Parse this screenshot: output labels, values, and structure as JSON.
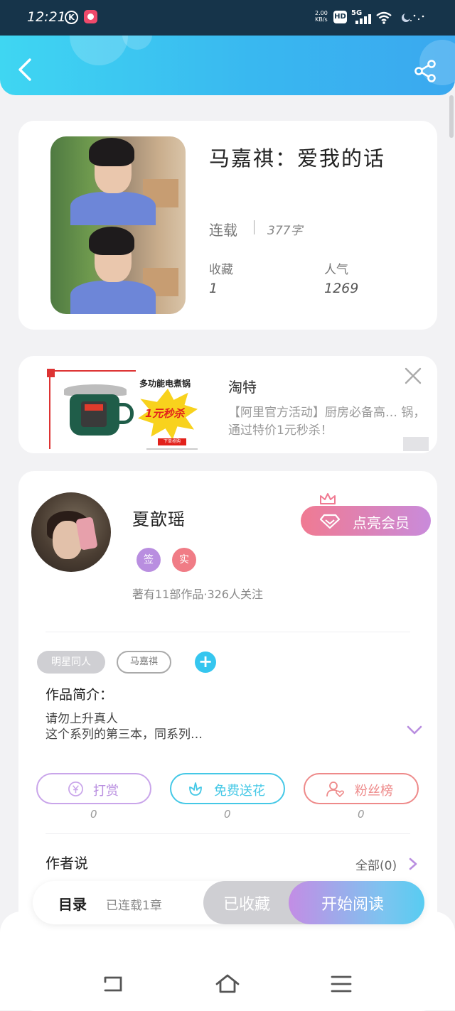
{
  "status_bar": {
    "time": "12:21",
    "k_icon": "K",
    "network_speed": "2.00\nKB/s",
    "hd": "HD",
    "signal": "5G"
  },
  "header": {
    "back_icon": "chevron-left-icon",
    "share_icon": "share-icon",
    "colors": {
      "gradient_start": "#3fd6f2",
      "gradient_end": "#3aa8ef"
    }
  },
  "book": {
    "title": "马嘉祺：爱我的话",
    "status": "连载",
    "word_count": "377字",
    "stats": [
      {
        "label": "收藏",
        "value": "1"
      },
      {
        "label": "人气",
        "value": "1269"
      }
    ]
  },
  "ad": {
    "product_headline": "多功能电煮锅",
    "promo_text": "1元秒杀",
    "promo_button": "下单抢购",
    "brand": "淘特",
    "description": "【阿里官方活动】厨房必备高… 锅，通过特价1元秒杀！",
    "close_icon": "close-icon"
  },
  "author": {
    "name": "夏歆瑶",
    "badges": [
      {
        "text": "签",
        "color": "#b98ee0"
      },
      {
        "text": "实",
        "color": "#f07c86"
      }
    ],
    "meta": "著有11部作品·326人关注",
    "vip_button": "点亮会员"
  },
  "tags": {
    "category": "明星同人",
    "tag": "马嘉祺",
    "add": "+"
  },
  "intro": {
    "label": "作品简介：",
    "text_line1": "请勿上升真人",
    "text_line2": "这个系列的第三本，同系列…"
  },
  "actions": [
    {
      "label": "打赏",
      "icon": "yen-coin-icon",
      "count": "0",
      "color": "#b98ee0"
    },
    {
      "label": "免费送花",
      "icon": "flower-icon",
      "count": "0",
      "color": "#45c8e6"
    },
    {
      "label": "粉丝榜",
      "icon": "user-heart-icon",
      "count": "0",
      "color": "#ee8a8a"
    }
  ],
  "author_says": {
    "label": "作者说",
    "all": "全部(0)"
  },
  "bottom_bar": {
    "toc_label": "目录",
    "toc_status": "已连载1章",
    "collected": "已收藏",
    "start_reading": "开始阅读"
  },
  "nav": {
    "back_icon": "nav-back-icon",
    "home_icon": "nav-home-icon",
    "menu_icon": "nav-menu-icon"
  }
}
